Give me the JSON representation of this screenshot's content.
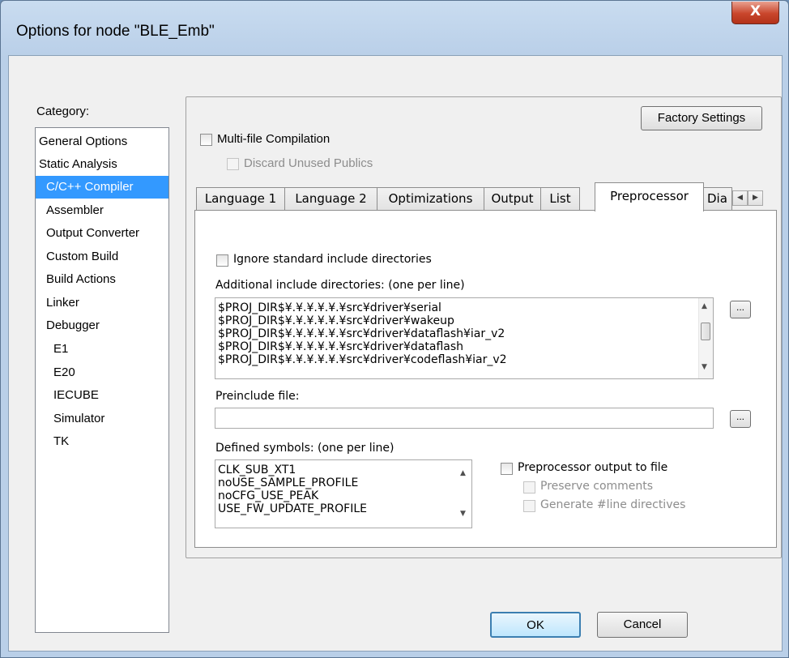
{
  "window": {
    "title": "Options for node \"BLE_Emb\"",
    "close_label": "X"
  },
  "category": {
    "label": "Category:",
    "items": [
      "General Options",
      "Static Analysis",
      "C/C++ Compiler",
      "Assembler",
      "Output Converter",
      "Custom Build",
      "Build Actions",
      "Linker",
      "Debugger",
      "E1",
      "E20",
      "IECUBE",
      "Simulator",
      "TK"
    ],
    "selected": "C/C++ Compiler"
  },
  "panel": {
    "factory_settings": "Factory Settings",
    "multi_file": "Multi-file Compilation",
    "discard_unused": "Discard Unused Publics"
  },
  "tabs": [
    "Language 1",
    "Language 2",
    "Optimizations",
    "Output",
    "List",
    "Preprocessor",
    "Dia"
  ],
  "active_tab": "Preprocessor",
  "preprocessor": {
    "ignore_std": "Ignore standard include directories",
    "include_label": "Additional include directories: (one per line)",
    "include_lines": [
      "$PROJ_DIR$¥.¥.¥.¥.¥.¥src¥driver¥serial",
      "$PROJ_DIR$¥.¥.¥.¥.¥.¥src¥driver¥wakeup",
      "$PROJ_DIR$¥.¥.¥.¥.¥.¥src¥driver¥dataflash¥iar_v2",
      "$PROJ_DIR$¥.¥.¥.¥.¥.¥src¥driver¥dataflash",
      "$PROJ_DIR$¥.¥.¥.¥.¥.¥src¥driver¥codeflash¥iar_v2"
    ],
    "browse_label": "...",
    "preinclude_label": "Preinclude file:",
    "preinclude_value": "",
    "symbols_label": "Defined symbols: (one per line)",
    "symbols": [
      "CLK_SUB_XT1",
      "noUSE_SAMPLE_PROFILE",
      "noCFG_USE_PEAK",
      "USE_FW_UPDATE_PROFILE"
    ],
    "output_to_file": "Preprocessor output to file",
    "preserve_comments": "Preserve comments",
    "generate_line": "Generate #line directives"
  },
  "buttons": {
    "ok": "OK",
    "cancel": "Cancel"
  }
}
